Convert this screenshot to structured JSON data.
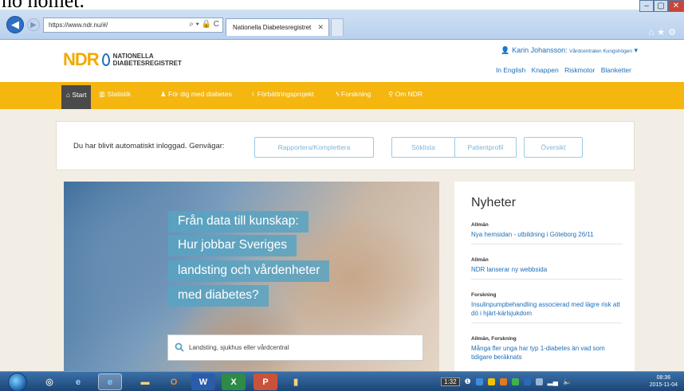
{
  "browser": {
    "url": "https://www.ndr.nu/#/",
    "url_actions": "⌕ ▾ 🔒 C",
    "tab_title": "Nationella Diabetesregistret",
    "window_controls": [
      "–",
      "▢",
      "✕"
    ]
  },
  "header": {
    "logo_ndr": "NDR",
    "logo_line1": "NATIONELLA",
    "logo_line2": "DIABETESREGISTRET",
    "user_name": "Karin Johansson:",
    "user_unit": "Vårdcentralen Kungshögen",
    "top_links": [
      "In English",
      "Knappen",
      "Riskmotor",
      "Blanketter"
    ]
  },
  "nav": {
    "items": [
      "Start",
      "Statistik",
      "För dig med diabetes",
      "Förbättringsprojekt",
      "Forskning",
      "Om NDR"
    ],
    "icons": [
      "home-icon",
      "bar-chart-icon",
      "person-icon",
      "lightbulb-icon",
      "bolt-icon",
      "map-pin-icon"
    ]
  },
  "quickbar": {
    "text": "Du har blivit automatiskt inloggad. Genvägar:",
    "buttons": [
      "Rapportera/Komplettera",
      "Söklista",
      "Patientprofil",
      "Översikt"
    ]
  },
  "hero": {
    "lines": [
      "Från data till kunskap:",
      "Hur jobbar Sveriges",
      "landsting och vårdenheter",
      "med diabetes?"
    ],
    "search_placeholder": "Landsting, sjukhus eller vårdcentral"
  },
  "news": {
    "heading": "Nyheter",
    "items": [
      {
        "category": "Allmän",
        "title": "Nya hemsidan - utbildning i Göteborg 26/11"
      },
      {
        "category": "Allmän",
        "title": "NDR lanserar ny webbsida"
      },
      {
        "category": "Forskning",
        "title": "Insulinpumpbehandling associerad med lägre risk att dö i hjärt-kärlsjukdom"
      },
      {
        "category": "Allmän, Forskning",
        "title": "Många fler unga har typ 1-diabetes än vad som tidigare beräknats"
      }
    ]
  },
  "taskbar": {
    "battery": "1:32",
    "clock_time": "08:36",
    "clock_date": "2015-11-04"
  },
  "colors": {
    "brand_yellow": "#f4b60f",
    "link_blue": "#1d6fb8",
    "hero_band": "#58a3c2"
  }
}
